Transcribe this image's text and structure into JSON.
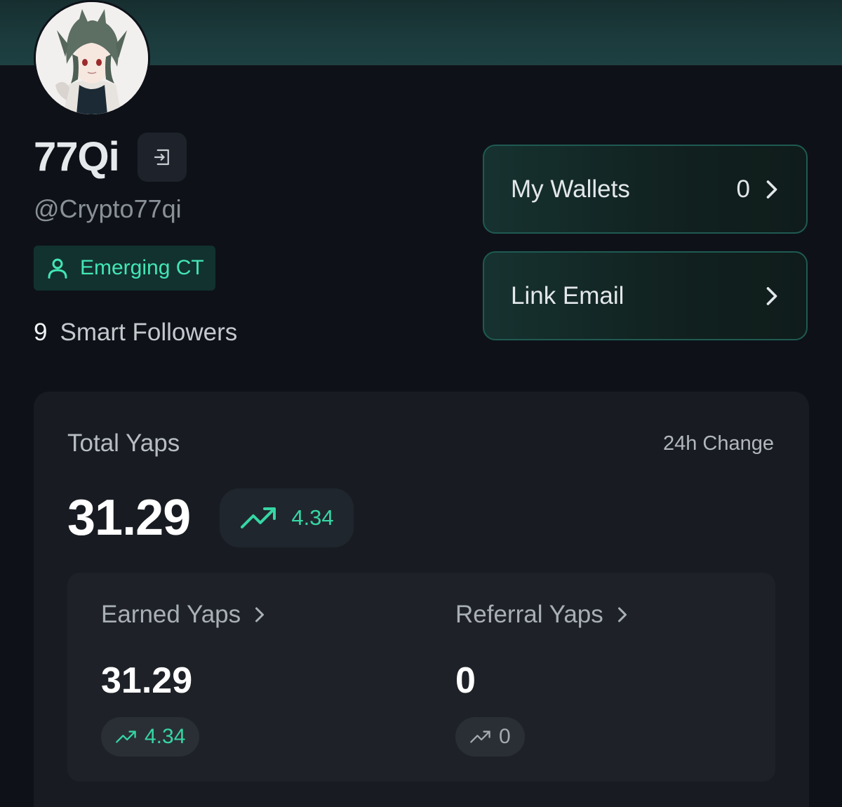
{
  "profile": {
    "display_name": "77Qi",
    "handle": "@Crypto77qi",
    "tier": "Emerging CT",
    "smart_followers_count": "9",
    "smart_followers_label": "Smart Followers"
  },
  "side_cards": {
    "wallets": {
      "label": "My Wallets",
      "count": "0"
    },
    "email": {
      "label": "Link Email"
    }
  },
  "yaps": {
    "total_label": "Total Yaps",
    "change_label": "24h Change",
    "total_value": "31.29",
    "total_change": "4.34",
    "earned": {
      "label": "Earned Yaps",
      "value": "31.29",
      "change": "4.34"
    },
    "referral": {
      "label": "Referral Yaps",
      "value": "0",
      "change": "0"
    }
  },
  "icons": {
    "logout": "logout-icon",
    "user": "user-icon",
    "chevron": "chevron-right-icon",
    "trend": "trending-up-icon"
  },
  "colors": {
    "accent_green": "#36d6a4",
    "tier_green": "#43e6b4",
    "card_border": "#1f5a52",
    "background": "#0e1218"
  }
}
